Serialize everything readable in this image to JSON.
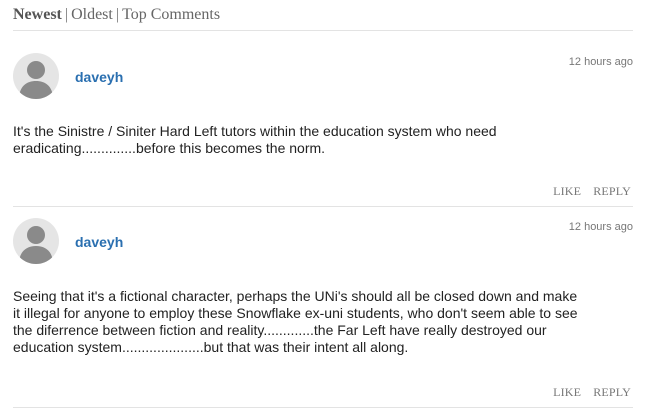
{
  "sort": {
    "newest": "Newest",
    "oldest": "Oldest",
    "top": "Top Comments",
    "separator": "|"
  },
  "comments": [
    {
      "author": "daveyh",
      "time": "12 hours ago",
      "lines": [
        "It's the Sinistre / Siniter Hard Left tutors within the education system who need",
        "eradicating..............before this becomes the norm."
      ],
      "like": "LIKE",
      "reply": "REPLY"
    },
    {
      "author": "daveyh",
      "time": "12 hours ago",
      "lines": [
        "Seeing that it's a fictional character, perhaps the UNi's should all be closed down and make",
        "it illegal for anyone to employ these Snowflake ex-uni students, who don't seem able to see",
        "the diferrence between fiction and reality.............the Far Left have really destroyed our",
        "education system.....................but that was their intent all along."
      ],
      "like": "LIKE",
      "reply": "REPLY"
    }
  ],
  "colors": {
    "author_link": "#2a6fb0",
    "avatar_bg": "#e5e5e5",
    "avatar_fg": "#8a8a8a"
  }
}
